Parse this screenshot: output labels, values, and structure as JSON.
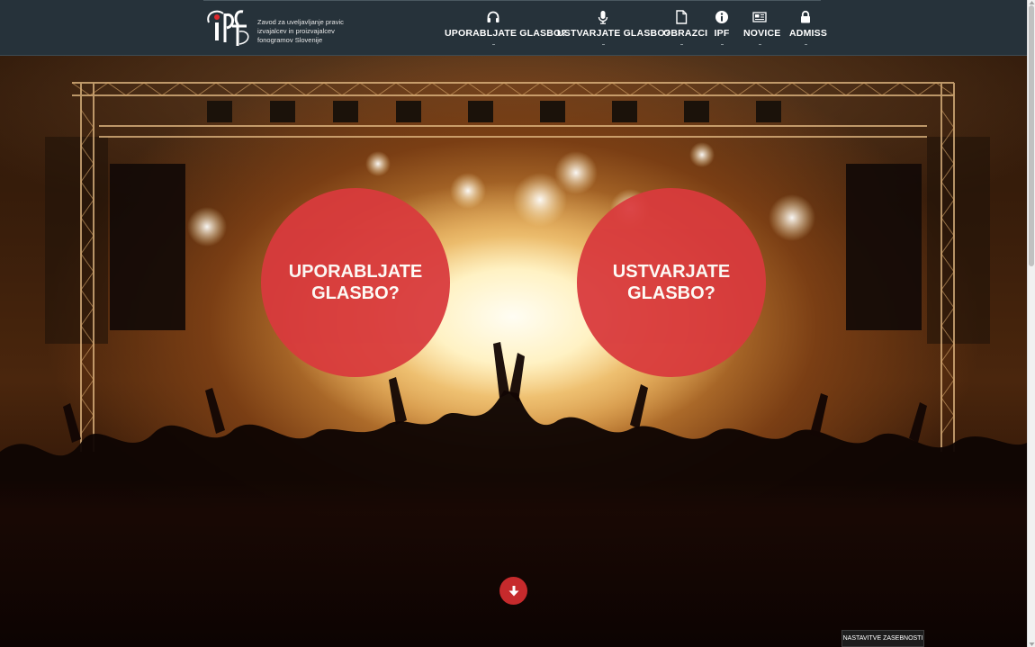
{
  "header": {
    "tagline_lines": [
      "Zavod za uveljavljanje pravic",
      "izvajalcev in proizvajalcev",
      "fonogramov Slovenije"
    ],
    "logo_icon": "ipf-logo",
    "nav": [
      {
        "label": "UPORABLJATE GLASBO?",
        "icon": "headphones-icon"
      },
      {
        "label": "USTVARJATE GLASBO?",
        "icon": "microphone-icon"
      },
      {
        "label": "OBRAZCI",
        "icon": "document-icon"
      },
      {
        "label": "IPF",
        "icon": "info-icon"
      },
      {
        "label": "NOVICE",
        "icon": "newspaper-icon"
      },
      {
        "label": "ADMISS",
        "icon": "lock-icon"
      }
    ]
  },
  "hero": {
    "left_circle": {
      "line1": "UPORABLJATE",
      "line2": "GLASBO?"
    },
    "right_circle": {
      "line1": "USTVARJATE",
      "line2": "GLASBO?"
    },
    "scroll_down_icon": "arrow-down-icon"
  },
  "footer": {
    "privacy_label": "NASTAVITVE ZASEBNOSTI"
  },
  "colors": {
    "header_bg": "#26323a",
    "circle_red": "#d93a3d",
    "button_red": "#c62a2c"
  }
}
